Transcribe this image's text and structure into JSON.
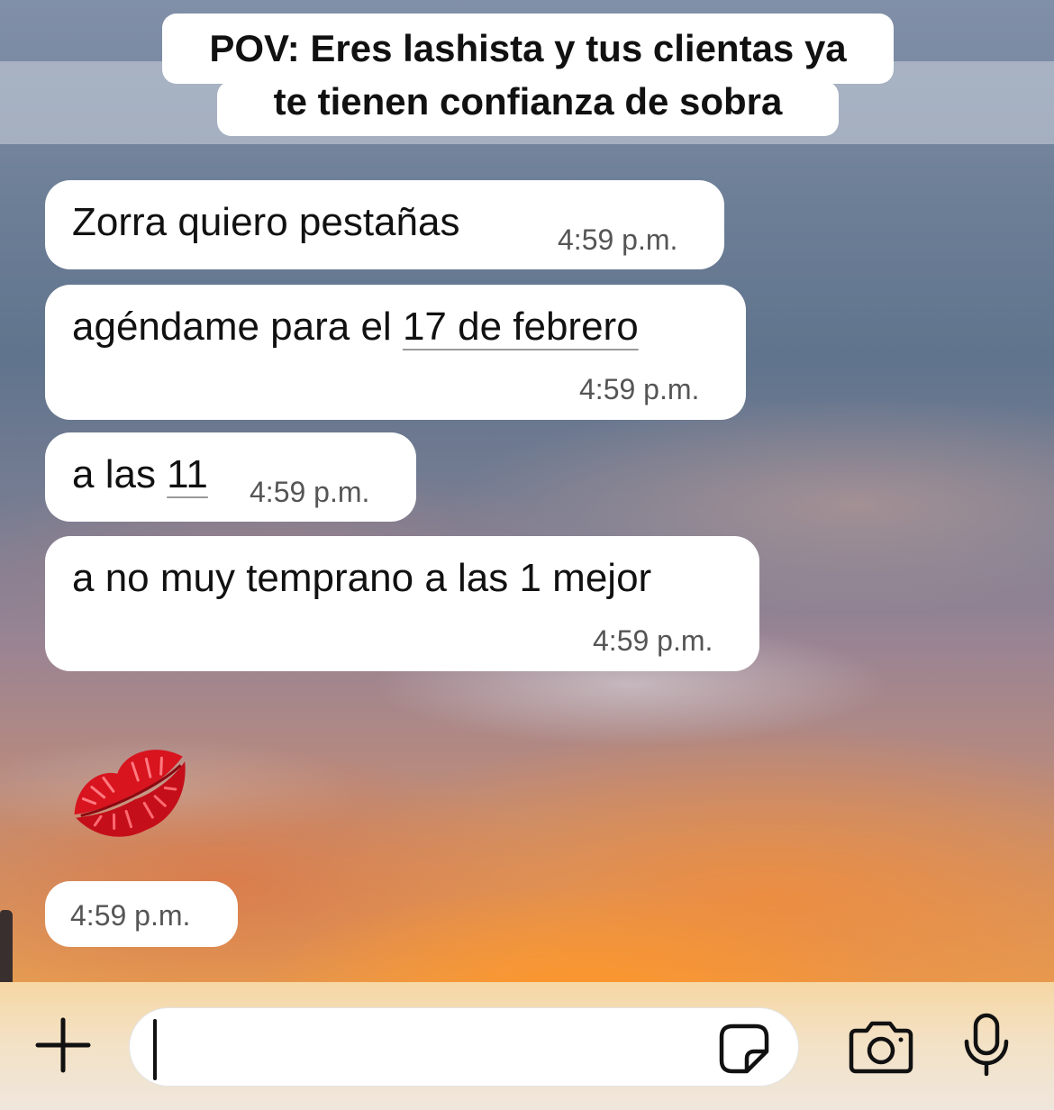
{
  "caption": {
    "line1": "POV: Eres lashista y tus clientas ya",
    "line2": "te tienen confianza de sobra"
  },
  "messages": [
    {
      "parts": [
        "Zorra quiero pestañas"
      ],
      "time": "4:59 p.m."
    },
    {
      "parts": [
        "agéndame para el ",
        "17 de febrero"
      ],
      "time": "4:59 p.m."
    },
    {
      "parts": [
        "a las ",
        "11"
      ],
      "time": "4:59 p.m."
    },
    {
      "parts": [
        "a no muy temprano a las 1 mejor"
      ],
      "time": "4:59 p.m."
    }
  ],
  "emoji_message": {
    "emoji": "kiss-mark",
    "time": "4:59 p.m."
  },
  "input_bar": {
    "plus_icon": "plus-icon",
    "text_value": "",
    "sticker_icon": "sticker-icon",
    "camera_icon": "camera-icon",
    "mic_icon": "microphone-icon"
  },
  "colors": {
    "bubble": "#ffffff",
    "lips": "#e0202a"
  }
}
